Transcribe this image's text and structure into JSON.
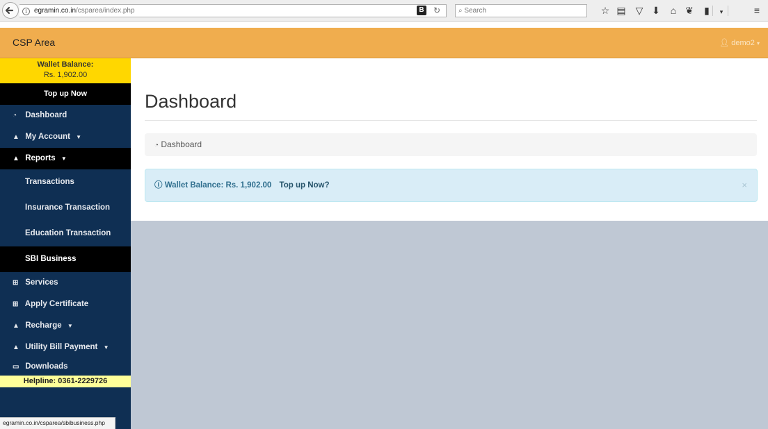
{
  "browser": {
    "url_host": "egramin.co.in",
    "url_path": "/csparea/index.php",
    "search_placeholder": "Search",
    "b_label": "B",
    "status_url": "egramin.co.in/csparea/sbibusiness.php"
  },
  "header": {
    "brand": "CSP Area",
    "user": "demo2"
  },
  "sidebar": {
    "wallet_label": "Wallet Balance:",
    "wallet_amount": "Rs. 1,902.00",
    "topup": "Top up Now",
    "items": [
      {
        "label": "Dashboard",
        "icon": "tachometer-icon"
      },
      {
        "label": "My Account",
        "icon": "user-icon"
      },
      {
        "label": "Reports",
        "icon": "user-icon"
      },
      {
        "label": "Services",
        "icon": "table-icon"
      },
      {
        "label": "Apply Certificate",
        "icon": "table-icon"
      },
      {
        "label": "Recharge",
        "icon": "user-icon"
      },
      {
        "label": "Utility Bill Payment",
        "icon": "user-icon"
      },
      {
        "label": "Downloads",
        "icon": "monitor-icon"
      }
    ],
    "report_subitems": [
      {
        "label": "Transactions"
      },
      {
        "label": "Insurance Transaction"
      },
      {
        "label": "Education Transaction"
      },
      {
        "label": "SBI Business"
      }
    ],
    "helpline": "Helpline: 0361-2229726"
  },
  "main": {
    "title": "Dashboard",
    "breadcrumb": "Dashboard",
    "alert_text": "Wallet Balance: Rs. 1,902.00",
    "alert_link": "Top up Now?",
    "alert_close": "×"
  },
  "colors": {
    "header_bg": "#f0ad4e",
    "sidebar_bg": "#0f2f53",
    "wallet_bg": "#ffd700",
    "helpline_bg": "#ffff99",
    "alert_bg": "#d9edf7",
    "content_gray": "#bfc8d4"
  }
}
